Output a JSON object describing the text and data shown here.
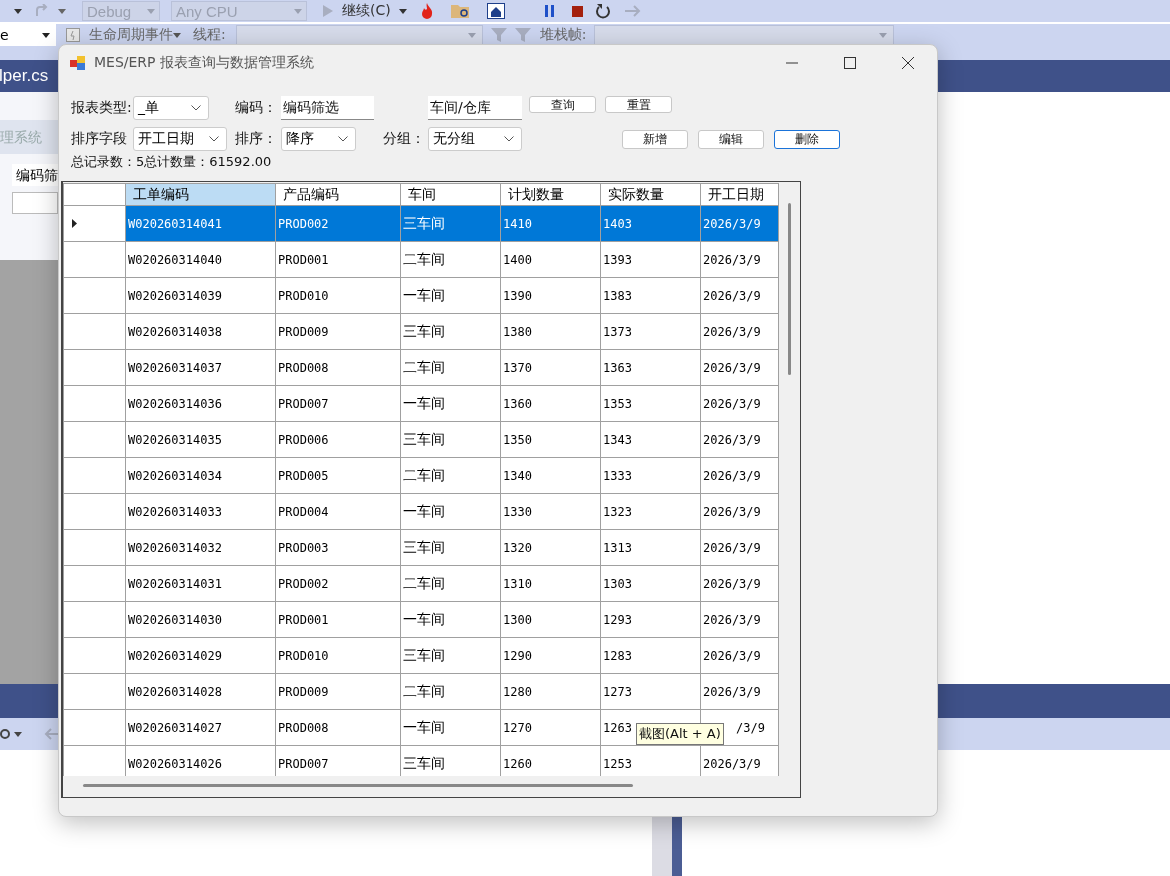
{
  "ide": {
    "toolbar": {
      "configuration": "Debug",
      "platform": "Any CPU",
      "continue": "继续(C)"
    },
    "debug_bar": {
      "combo_text": "e",
      "lifecycle": "生命周期事件",
      "thread_label": "线程:",
      "stack_label": "堆栈帧:"
    },
    "tab": "lper.cs",
    "side_panel": {
      "title": "理系统",
      "field": "编码筛"
    }
  },
  "window": {
    "title": "MES/ERP 报表查询与数据管理系统"
  },
  "filters": {
    "report_type": {
      "label": "报表类型:",
      "value": "_单"
    },
    "code": {
      "label": "编码：",
      "value": "编码筛选"
    },
    "workshop": {
      "value": "车间/仓库"
    },
    "sort_field": {
      "label": "排序字段",
      "value": "开工日期"
    },
    "sort_order": {
      "label": "排序：",
      "value": "降序"
    },
    "grouping": {
      "label": "分组：",
      "value": "无分组"
    }
  },
  "query_buttons": [
    {
      "label": "查询",
      "focused": false
    },
    {
      "label": "重置",
      "focused": false
    }
  ],
  "action_buttons": [
    {
      "label": "新增",
      "focused": false
    },
    {
      "label": "编辑",
      "focused": false
    },
    {
      "label": "删除",
      "focused": true
    }
  ],
  "summary": {
    "record_count": "总记录数：5",
    "total_quantity": "总计数量：61592.00"
  },
  "table": {
    "columns": [
      {
        "label": "工单编码",
        "selected": true
      },
      {
        "label": "产品编码",
        "selected": false
      },
      {
        "label": "车间",
        "selected": false
      },
      {
        "label": "计划数量",
        "selected": false
      },
      {
        "label": "实际数量",
        "selected": false
      },
      {
        "label": "开工日期",
        "selected": false
      }
    ],
    "rows": [
      {
        "selected": true,
        "cells": [
          "W020260314041",
          "PROD002",
          "三车间",
          "1410",
          "1403",
          "2026/3/9"
        ]
      },
      {
        "selected": false,
        "cells": [
          "W020260314040",
          "PROD001",
          "二车间",
          "1400",
          "1393",
          "2026/3/9"
        ]
      },
      {
        "selected": false,
        "cells": [
          "W020260314039",
          "PROD010",
          "一车间",
          "1390",
          "1383",
          "2026/3/9"
        ]
      },
      {
        "selected": false,
        "cells": [
          "W020260314038",
          "PROD009",
          "三车间",
          "1380",
          "1373",
          "2026/3/9"
        ]
      },
      {
        "selected": false,
        "cells": [
          "W020260314037",
          "PROD008",
          "二车间",
          "1370",
          "1363",
          "2026/3/9"
        ]
      },
      {
        "selected": false,
        "cells": [
          "W020260314036",
          "PROD007",
          "一车间",
          "1360",
          "1353",
          "2026/3/9"
        ]
      },
      {
        "selected": false,
        "cells": [
          "W020260314035",
          "PROD006",
          "三车间",
          "1350",
          "1343",
          "2026/3/9"
        ]
      },
      {
        "selected": false,
        "cells": [
          "W020260314034",
          "PROD005",
          "二车间",
          "1340",
          "1333",
          "2026/3/9"
        ]
      },
      {
        "selected": false,
        "cells": [
          "W020260314033",
          "PROD004",
          "一车间",
          "1330",
          "1323",
          "2026/3/9"
        ]
      },
      {
        "selected": false,
        "cells": [
          "W020260314032",
          "PROD003",
          "三车间",
          "1320",
          "1313",
          "2026/3/9"
        ]
      },
      {
        "selected": false,
        "cells": [
          "W020260314031",
          "PROD002",
          "二车间",
          "1310",
          "1303",
          "2026/3/9"
        ]
      },
      {
        "selected": false,
        "cells": [
          "W020260314030",
          "PROD001",
          "一车间",
          "1300",
          "1293",
          "2026/3/9"
        ]
      },
      {
        "selected": false,
        "cells": [
          "W020260314029",
          "PROD010",
          "三车间",
          "1290",
          "1283",
          "2026/3/9"
        ]
      },
      {
        "selected": false,
        "cells": [
          "W020260314028",
          "PROD009",
          "二车间",
          "1280",
          "1273",
          "2026/3/9"
        ]
      },
      {
        "selected": false,
        "cells": [
          "W020260314027",
          "PROD008",
          "一车间",
          "1270",
          "1263",
          "/3/9"
        ],
        "tooltip": "截图(Alt + A)"
      },
      {
        "selected": false,
        "cells": [
          "W020260314026",
          "PROD007",
          "三车间",
          "1260",
          "1253",
          "2026/3/9"
        ]
      }
    ]
  }
}
